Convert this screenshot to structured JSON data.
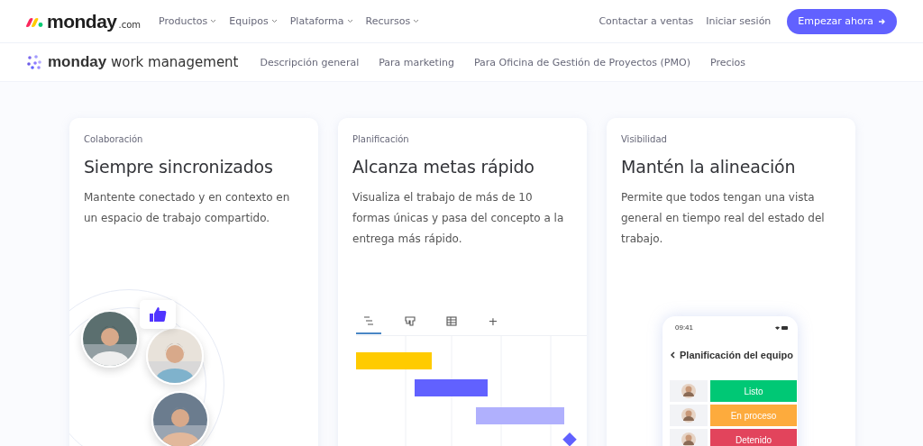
{
  "header": {
    "logo": {
      "wordmark": "monday",
      "suffix": ".com"
    },
    "menu": [
      {
        "label": "Productos"
      },
      {
        "label": "Equipos"
      },
      {
        "label": "Plataforma"
      },
      {
        "label": "Recursos"
      }
    ],
    "links": [
      "Contactar a ventas",
      "Iniciar sesión"
    ],
    "cta": "Empezar ahora"
  },
  "subnav": {
    "brand_bold": "monday",
    "brand_rest": "work management",
    "links": [
      "Descripción general",
      "Para marketing",
      "Para Oficina de Gestión de Proyectos (PMO)",
      "Precios"
    ]
  },
  "cards": [
    {
      "kind": "people",
      "eyebrow": "Colaboración",
      "title": "Siempre sincronizados",
      "text": "Mantente conectado y en contexto en un espacio de trabajo compartido."
    },
    {
      "kind": "gantt",
      "eyebrow": "Planificación",
      "title": "Alcanza metas rápido",
      "text": "Visualiza el trabajo de más de 10 formas únicas y pasa del concepto a la entrega más rápido.",
      "views": [
        {
          "kind": "timeline",
          "selected": true
        },
        {
          "kind": "kanban",
          "selected": false
        },
        {
          "kind": "table",
          "selected": false
        },
        {
          "kind": "add",
          "label": "+",
          "selected": false
        }
      ]
    },
    {
      "kind": "phone",
      "eyebrow": "Visibilidad",
      "title": "Mantén la alineación",
      "text": "Permite que todos tengan una vista general en tiempo real del estado del trabajo.",
      "phone": {
        "time": "09:41",
        "title": "Planificación del equipo",
        "rows": [
          {
            "status": "Listo",
            "color": "#00c875"
          },
          {
            "status": "En proceso",
            "color": "#fdab3d"
          },
          {
            "status": "Detenido",
            "color": "#e2445c"
          }
        ]
      }
    }
  ]
}
